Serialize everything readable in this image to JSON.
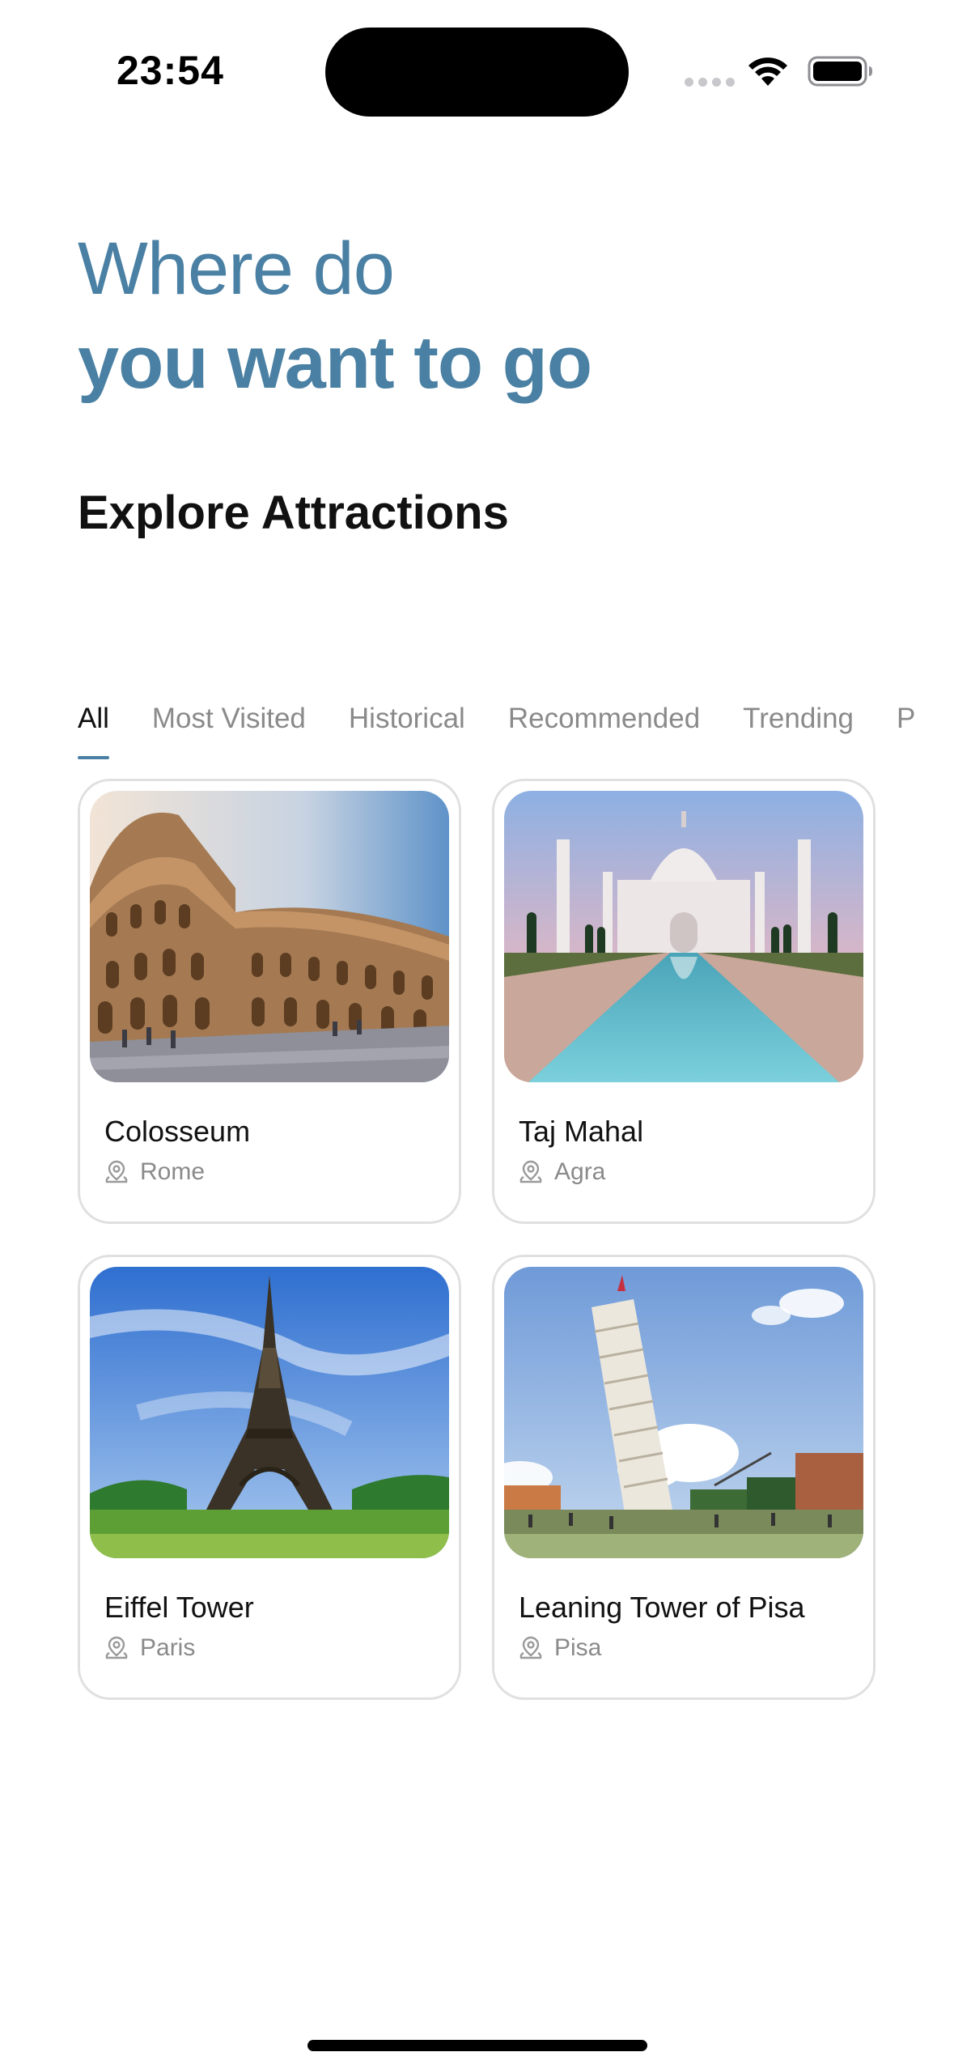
{
  "status_bar": {
    "time": "23:54"
  },
  "header": {
    "line1": "Where do",
    "line2": "you want to go"
  },
  "section": {
    "title": "Explore Attractions"
  },
  "tabs": [
    {
      "label": "All",
      "active": true
    },
    {
      "label": "Most Visited",
      "active": false
    },
    {
      "label": "Historical",
      "active": false
    },
    {
      "label": "Recommended",
      "active": false
    },
    {
      "label": "Trending",
      "active": false
    },
    {
      "label": "P",
      "active": false
    }
  ],
  "attractions": [
    {
      "name": "Colosseum",
      "location": "Rome"
    },
    {
      "name": "Taj Mahal",
      "location": "Agra"
    },
    {
      "name": "Eiffel Tower",
      "location": "Paris"
    },
    {
      "name": "Leaning Tower of Pisa",
      "location": "Pisa"
    }
  ],
  "colors": {
    "accent": "#4a80a3",
    "text_primary": "#111111",
    "text_secondary": "#8a8a8a",
    "card_border": "#e0e0e0"
  }
}
